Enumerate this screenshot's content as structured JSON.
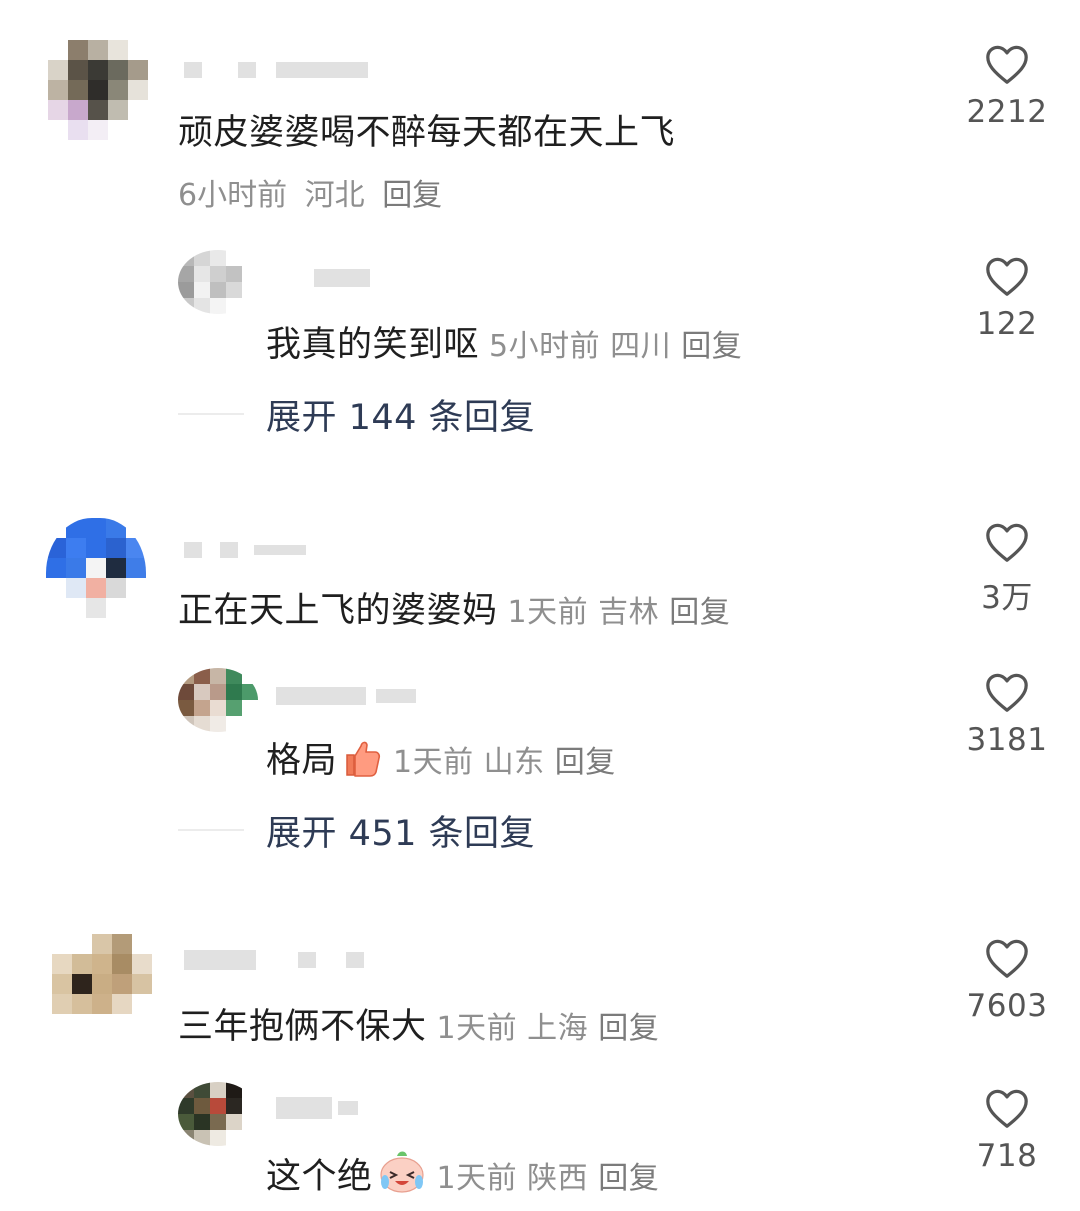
{
  "colors": {
    "text": "#1f1f1f",
    "meta": "#8f8f8f",
    "expand": "#2e3b55",
    "like_icon": "#555555"
  },
  "comments": [
    {
      "text": "顽皮婆婆喝不醉每天都在天上飞",
      "time": "6小时前",
      "location": "河北",
      "reply_label": "回复",
      "likes": "2212",
      "icon": "heart-outline-icon",
      "sub_reply": {
        "text": "我真的笑到呕",
        "time": "5小时前",
        "location": "四川",
        "reply_label": "回复",
        "likes": "122"
      },
      "expand_label": "展开 144 条回复"
    },
    {
      "text": "正在天上飞的婆婆妈",
      "time": "1天前",
      "location": "吉林",
      "reply_label": "回复",
      "likes": "3万",
      "sub_reply": {
        "text": "格局",
        "emoji": "thumbs-up-emoji",
        "time": "1天前",
        "location": "山东",
        "reply_label": "回复",
        "likes": "3181"
      },
      "expand_label": "展开 451 条回复"
    },
    {
      "text": "三年抱俩不保大",
      "time": "1天前",
      "location": "上海",
      "reply_label": "回复",
      "likes": "7603",
      "sub_reply": {
        "text": "这个绝",
        "emoji": "crying-laughing-emoji",
        "time": "1天前",
        "location": "陕西",
        "reply_label": "回复",
        "likes": "718"
      }
    }
  ]
}
